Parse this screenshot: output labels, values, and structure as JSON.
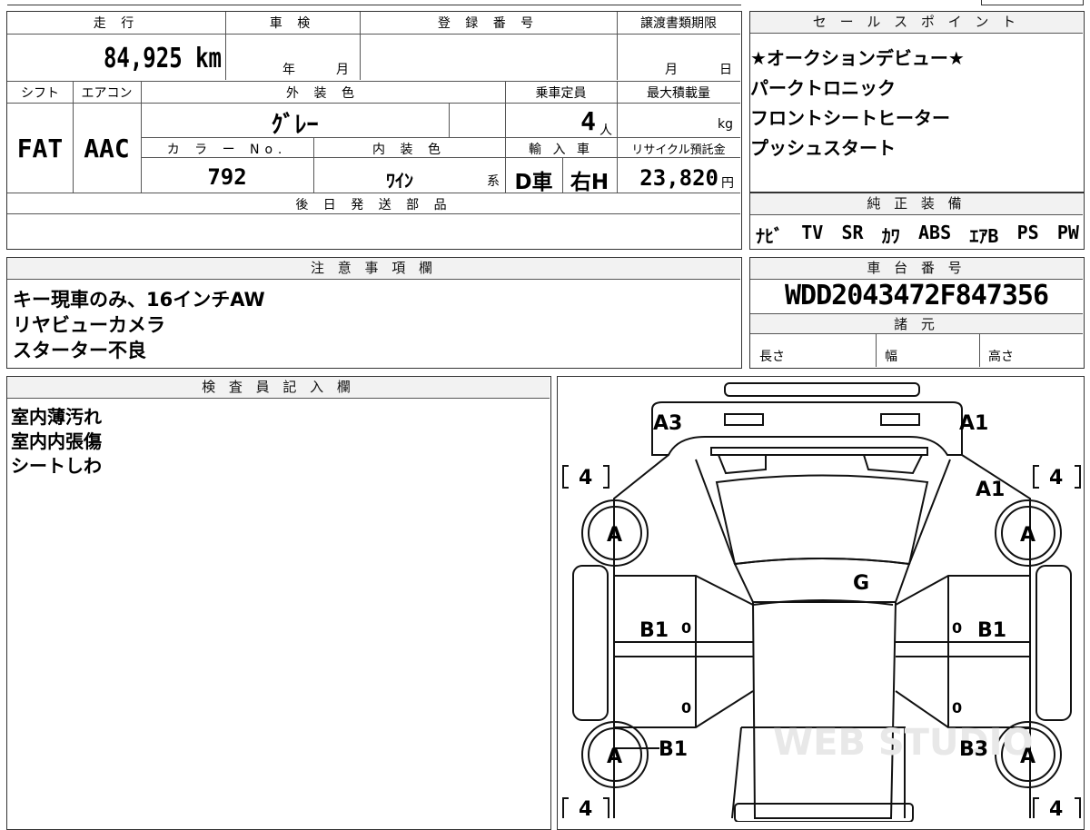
{
  "top_left": {
    "headers": {
      "mileage": "走 行",
      "shaken": "車 検",
      "registration": "登 録 番 号",
      "transfer_deadline": "譲渡書類期限",
      "shift": "シフト",
      "aircon": "エアコン",
      "exterior_color": "外 装 色",
      "capacity": "乗車定員",
      "max_load": "最大積載量",
      "color_no": "カ ラ ー No.",
      "interior_color": "内 装 色",
      "import": "輸 入 車",
      "recycle_fee": "リサイクル預託金",
      "later_parts": "後 日 発 送 部 品"
    },
    "values": {
      "mileage": "84,925",
      "mileage_unit": "km",
      "shaken_year": "年",
      "shaken_month": "月",
      "deadline_month": "月",
      "deadline_day": "日",
      "shift": "FAT",
      "aircon": "AAC",
      "exterior_color": "ｸﾞﾚｰ",
      "capacity": "4",
      "capacity_unit": "人",
      "max_load_unit": "kg",
      "color_no": "792",
      "interior_color": "ﾜｲﾝ",
      "interior_suffix": "系",
      "import_type": "D車",
      "handle": "右H",
      "recycle_fee": "23,820",
      "recycle_unit": "円"
    }
  },
  "sales_points": {
    "header": "セ ー ル ス ポ イ ン ト",
    "items": [
      "★オークションデビュー★",
      "パークトロニック",
      "フロントシートヒーター",
      "プッシュスタート"
    ]
  },
  "equipment": {
    "header": "純 正 装 備",
    "items": [
      "ﾅﾋﾞ",
      "TV",
      "SR",
      "ｶﾜ",
      "ABS",
      "ｴｱB",
      "PS",
      "PW"
    ]
  },
  "notes": {
    "header": "注 意 事 項 欄",
    "lines": [
      "キー現車のみ、16インチAW",
      "リヤビューカメラ",
      "スターター不良"
    ]
  },
  "chassis": {
    "header": "車 台 番 号",
    "number": "WDD2043472F847356",
    "specs_header": "諸 元",
    "length": "長さ",
    "width": "幅",
    "height": "高さ"
  },
  "inspector": {
    "header": "検 査 員 記 入 欄",
    "lines": [
      "室内薄汚れ",
      "室内内張傷",
      "シートしわ"
    ]
  },
  "diagram": {
    "marks": {
      "rear_left": "A3",
      "rear_right": "A1",
      "right_rear_quarter": "A1",
      "roof": "G",
      "door_left_rear": "B1",
      "door_right_rear": "B1",
      "front_left": "B1",
      "front_right": "B3",
      "wheel": "A"
    },
    "tire_tread": "4",
    "zero": "0",
    "watermark": "WEB STUDIO"
  }
}
